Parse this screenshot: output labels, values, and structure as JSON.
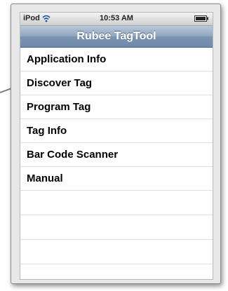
{
  "status_bar": {
    "carrier": "iPod",
    "wifi_icon": "wifi-icon",
    "time": "10:53 AM",
    "battery_icon": "battery-icon"
  },
  "nav_bar": {
    "title": "Rubee TagTool"
  },
  "menu": {
    "items": [
      {
        "label": "Application Info"
      },
      {
        "label": "Discover Tag"
      },
      {
        "label": "Program Tag"
      },
      {
        "label": "Tag Info"
      },
      {
        "label": "Bar Code Scanner"
      },
      {
        "label": "Manual"
      }
    ],
    "empty_rows": 4
  },
  "colors": {
    "nav_bar": "#7c94b2",
    "pointer_arrow": "#8c7c7c"
  }
}
